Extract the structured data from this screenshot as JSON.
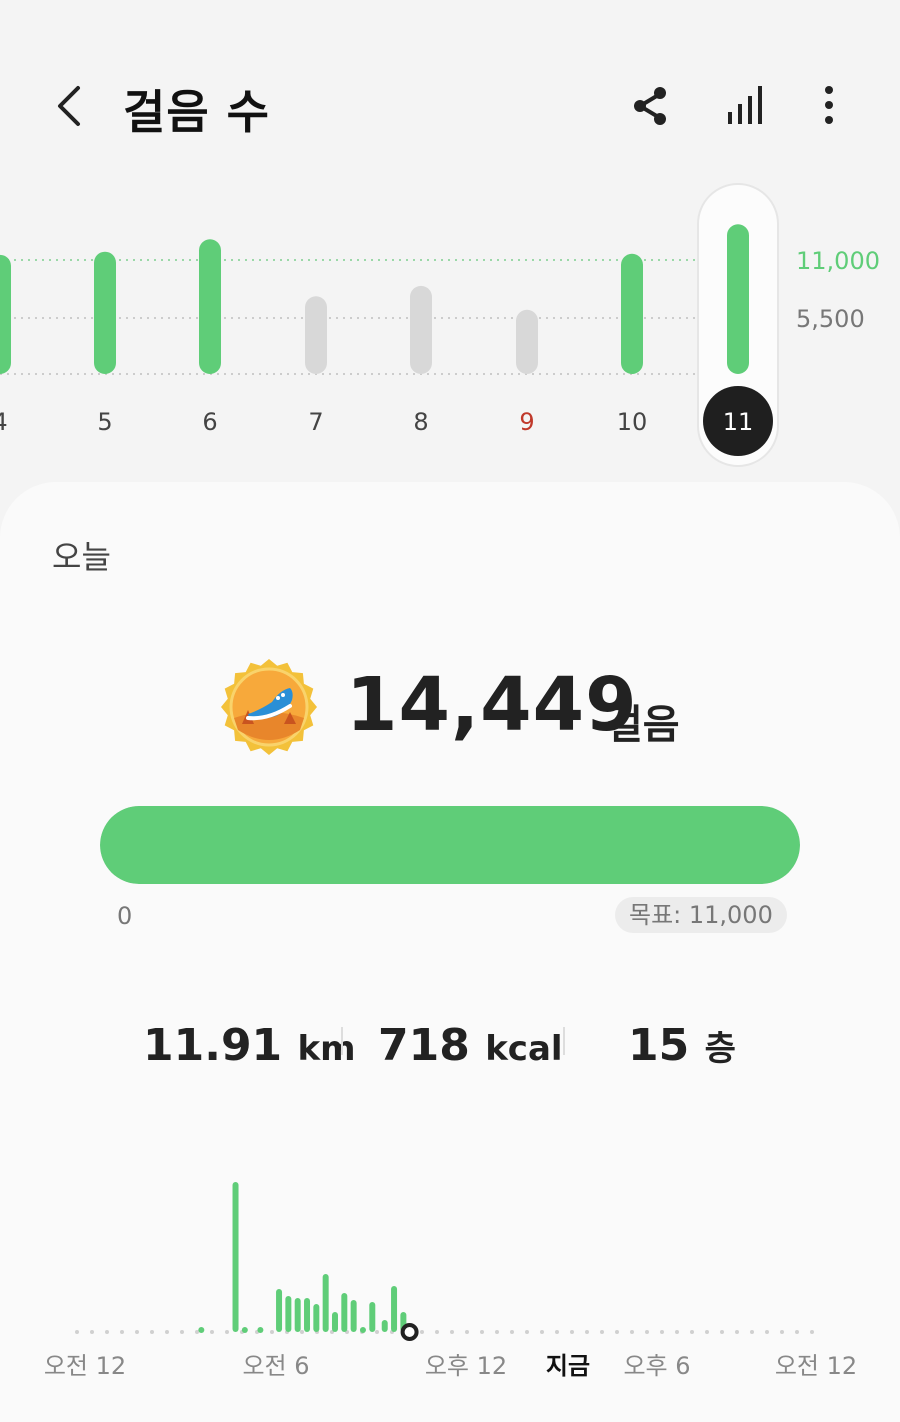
{
  "header": {
    "title": "걸음 수",
    "back_icon": "chevron-left-icon",
    "actions": [
      "share-icon",
      "bar-chart-icon",
      "more-vert-icon"
    ]
  },
  "weekly_chart": {
    "days": [
      {
        "label": "4",
        "steps": 11500,
        "goal_met": true
      },
      {
        "label": "5",
        "steps": 11800,
        "goal_met": true
      },
      {
        "label": "6",
        "steps": 13000,
        "goal_met": true
      },
      {
        "label": "7",
        "steps": 7500,
        "goal_met": false
      },
      {
        "label": "8",
        "steps": 8500,
        "goal_met": false
      },
      {
        "label": "9",
        "steps": 6200,
        "goal_met": false,
        "weekend": true
      },
      {
        "label": "10",
        "steps": 11600,
        "goal_met": true
      },
      {
        "label": "11",
        "steps": 14449,
        "goal_met": true,
        "selected": true
      }
    ],
    "y_labels": [
      "11,000",
      "5,500"
    ],
    "goal_color": "#5fcd78",
    "below_goal_color": "#d8d8d8",
    "weekend_label_color": "#c0392b"
  },
  "today": {
    "label": "오늘",
    "medal_icon": "running-shoe-medal-icon",
    "steps": "14,449",
    "steps_unit": "걸음",
    "progress_fraction": 1.0,
    "progress_min": "0",
    "goal": "목표: 11,000"
  },
  "metrics": {
    "distance_value": "11.91",
    "distance_unit": "km",
    "calories_value": "718",
    "calories_unit": "kcal",
    "floors_value": "15",
    "floors_unit": "층"
  },
  "hourly_chart": {
    "x_labels": [
      "오전 12",
      "오전 6",
      "오후 12",
      "지금",
      "오후 6",
      "오전 12"
    ],
    "bars": [
      {
        "hour": 4.0,
        "value": 4
      },
      {
        "hour": 5.1,
        "value": 150
      },
      {
        "hour": 5.4,
        "value": 4
      },
      {
        "hour": 5.9,
        "value": 4
      },
      {
        "hour": 6.5,
        "value": 43
      },
      {
        "hour": 6.8,
        "value": 36
      },
      {
        "hour": 7.1,
        "value": 34
      },
      {
        "hour": 7.4,
        "value": 34
      },
      {
        "hour": 7.7,
        "value": 28
      },
      {
        "hour": 8.0,
        "value": 58
      },
      {
        "hour": 8.3,
        "value": 20
      },
      {
        "hour": 8.6,
        "value": 39
      },
      {
        "hour": 8.9,
        "value": 32
      },
      {
        "hour": 9.2,
        "value": 4
      },
      {
        "hour": 9.5,
        "value": 30
      },
      {
        "hour": 9.9,
        "value": 12
      },
      {
        "hour": 10.2,
        "value": 46
      },
      {
        "hour": 10.5,
        "value": 20
      }
    ],
    "now_hour": 10.7
  }
}
